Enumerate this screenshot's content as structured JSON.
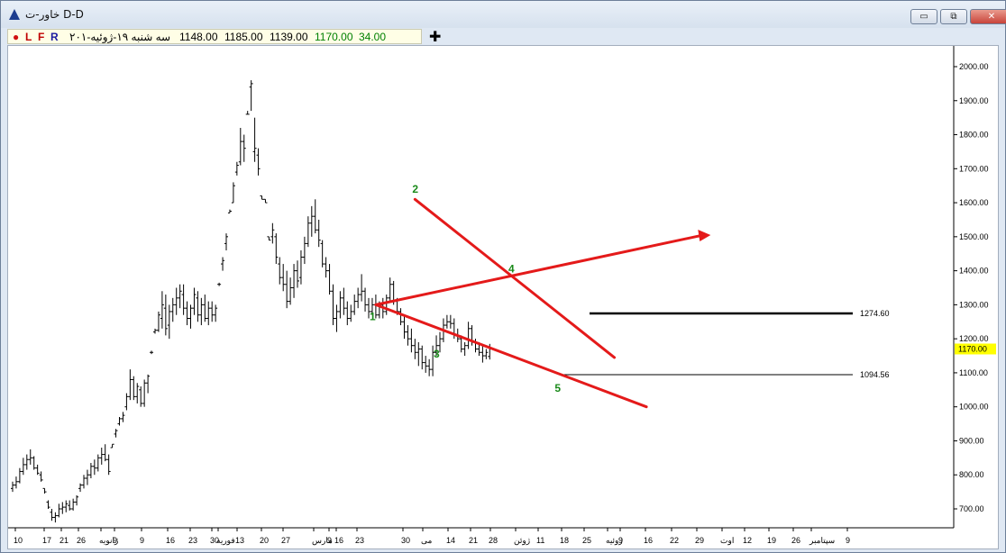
{
  "window": {
    "title": "خاور-ت D-D",
    "minimize_icon": "minimize-icon",
    "maximize_icon": "restore-icon",
    "close_icon": "close-icon",
    "minimize_label": "▭",
    "restore_label": "⧉",
    "close_label": "✕"
  },
  "infobar": {
    "dot": "●",
    "l": "L",
    "f": "F",
    "r": "R",
    "date": "سه شنبه ۱۹-ژوئیه-۲۰۱",
    "open": "1148.00",
    "high": "1185.00",
    "low": "1139.00",
    "close": "1170.00",
    "change": "34.00",
    "colors": {
      "dot": "#d01010",
      "l": "#c00000",
      "f": "#c00000",
      "r": "#1a1aa0",
      "close": "#008000",
      "change": "#008000"
    }
  },
  "toolbar": {
    "add_label": "✚",
    "add_icon": "crosshair-plus-icon"
  },
  "chart_data": {
    "type": "ohlc-bar",
    "y_axis": {
      "min": 600,
      "max": 2050,
      "ticks": [
        700,
        800,
        900,
        1000,
        1100,
        1200,
        1300,
        1400,
        1500,
        1600,
        1700,
        1800,
        1900,
        2000
      ],
      "tick_labels": [
        "700.00",
        "800.00",
        "900.00",
        "1000.00",
        "1100.00",
        "1200.00",
        "1300.00",
        "1400.00",
        "1500.00",
        "1600.00",
        "1700.00",
        "1800.00",
        "1900.00",
        "2000.00"
      ]
    },
    "x_axis": {
      "labels": [
        "10",
        "17",
        "21",
        "26",
        "9",
        "ژانویه",
        "9",
        "16",
        "23",
        "30",
        "فوریه",
        "13",
        "20",
        "27",
        "مارس",
        "9",
        "16",
        "23",
        "30",
        "می",
        "14",
        "21",
        "28",
        "ژوئن",
        "11",
        "18",
        "25",
        "ژوئیه",
        "9",
        "16",
        "22",
        "29",
        "اوت",
        "12",
        "19",
        "26",
        "سپتامبر",
        "9"
      ]
    },
    "last_price": {
      "value": 1170.0,
      "label": "1170.00",
      "color": "#ffff00"
    },
    "levels": [
      {
        "value": 1274.6,
        "label": "1274.60",
        "color": "#000000",
        "width": "thick"
      },
      {
        "value": 1094.56,
        "label": "1094.56",
        "color": "#000000",
        "width": "thin"
      }
    ],
    "wave_labels": [
      "1",
      "2",
      "3",
      "4",
      "5"
    ],
    "wave_label_color": "#1a8a1a",
    "line_color": "#e41a1a",
    "bars": [
      {
        "o": 760,
        "h": 780,
        "l": 750,
        "c": 770
      },
      {
        "o": 770,
        "h": 795,
        "l": 760,
        "c": 780
      },
      {
        "o": 780,
        "h": 820,
        "l": 775,
        "c": 810
      },
      {
        "o": 810,
        "h": 850,
        "l": 800,
        "c": 830
      },
      {
        "o": 830,
        "h": 860,
        "l": 815,
        "c": 845
      },
      {
        "o": 845,
        "h": 875,
        "l": 830,
        "c": 850
      },
      {
        "o": 850,
        "h": 855,
        "l": 815,
        "c": 820
      },
      {
        "o": 820,
        "h": 830,
        "l": 800,
        "c": 805
      },
      {
        "o": 800,
        "h": 810,
        "l": 780,
        "c": 785
      },
      {
        "o": 760,
        "h": 760,
        "l": 745,
        "c": 750
      },
      {
        "o": 720,
        "h": 725,
        "l": 700,
        "c": 705
      },
      {
        "o": 690,
        "h": 700,
        "l": 665,
        "c": 675
      },
      {
        "o": 675,
        "h": 690,
        "l": 660,
        "c": 680
      },
      {
        "o": 680,
        "h": 715,
        "l": 675,
        "c": 700
      },
      {
        "o": 700,
        "h": 720,
        "l": 685,
        "c": 705
      },
      {
        "o": 705,
        "h": 725,
        "l": 690,
        "c": 715
      },
      {
        "o": 710,
        "h": 725,
        "l": 695,
        "c": 700
      },
      {
        "o": 700,
        "h": 730,
        "l": 695,
        "c": 720
      },
      {
        "o": 720,
        "h": 740,
        "l": 710,
        "c": 735
      },
      {
        "o": 760,
        "h": 775,
        "l": 750,
        "c": 770
      },
      {
        "o": 770,
        "h": 800,
        "l": 760,
        "c": 790
      },
      {
        "o": 790,
        "h": 815,
        "l": 770,
        "c": 800
      },
      {
        "o": 800,
        "h": 835,
        "l": 790,
        "c": 825
      },
      {
        "o": 825,
        "h": 845,
        "l": 800,
        "c": 820
      },
      {
        "o": 820,
        "h": 860,
        "l": 810,
        "c": 850
      },
      {
        "o": 850,
        "h": 880,
        "l": 830,
        "c": 860
      },
      {
        "o": 860,
        "h": 890,
        "l": 840,
        "c": 845
      },
      {
        "o": 845,
        "h": 860,
        "l": 800,
        "c": 810
      },
      {
        "o": 880,
        "h": 890,
        "l": 880,
        "c": 890
      },
      {
        "o": 920,
        "h": 935,
        "l": 910,
        "c": 930
      },
      {
        "o": 950,
        "h": 970,
        "l": 945,
        "c": 965
      },
      {
        "o": 965,
        "h": 985,
        "l": 955,
        "c": 975
      },
      {
        "o": 1000,
        "h": 1040,
        "l": 990,
        "c": 1030
      },
      {
        "o": 1030,
        "h": 1110,
        "l": 1020,
        "c": 1080
      },
      {
        "o": 1080,
        "h": 1090,
        "l": 1020,
        "c": 1030
      },
      {
        "o": 1030,
        "h": 1070,
        "l": 1010,
        "c": 1060
      },
      {
        "o": 1050,
        "h": 1060,
        "l": 1000,
        "c": 1010
      },
      {
        "o": 1010,
        "h": 1080,
        "l": 1000,
        "c": 1070
      },
      {
        "o": 1070,
        "h": 1095,
        "l": 1040,
        "c": 1090
      },
      {
        "o": 1160,
        "h": 1165,
        "l": 1155,
        "c": 1160
      },
      {
        "o": 1220,
        "h": 1230,
        "l": 1215,
        "c": 1225
      },
      {
        "o": 1225,
        "h": 1280,
        "l": 1220,
        "c": 1270
      },
      {
        "o": 1260,
        "h": 1340,
        "l": 1230,
        "c": 1300
      },
      {
        "o": 1290,
        "h": 1330,
        "l": 1210,
        "c": 1230
      },
      {
        "o": 1240,
        "h": 1300,
        "l": 1200,
        "c": 1280
      },
      {
        "o": 1280,
        "h": 1320,
        "l": 1250,
        "c": 1300
      },
      {
        "o": 1300,
        "h": 1350,
        "l": 1270,
        "c": 1320
      },
      {
        "o": 1320,
        "h": 1360,
        "l": 1290,
        "c": 1340
      },
      {
        "o": 1330,
        "h": 1360,
        "l": 1270,
        "c": 1290
      },
      {
        "o": 1290,
        "h": 1310,
        "l": 1240,
        "c": 1260
      },
      {
        "o": 1260,
        "h": 1300,
        "l": 1230,
        "c": 1290
      },
      {
        "o": 1290,
        "h": 1350,
        "l": 1270,
        "c": 1330
      },
      {
        "o": 1320,
        "h": 1340,
        "l": 1250,
        "c": 1270
      },
      {
        "o": 1270,
        "h": 1320,
        "l": 1240,
        "c": 1300
      },
      {
        "o": 1300,
        "h": 1330,
        "l": 1250,
        "c": 1260
      },
      {
        "o": 1260,
        "h": 1310,
        "l": 1240,
        "c": 1290
      },
      {
        "o": 1290,
        "h": 1310,
        "l": 1250,
        "c": 1270
      },
      {
        "o": 1270,
        "h": 1300,
        "l": 1250,
        "c": 1290
      },
      {
        "o": 1360,
        "h": 1365,
        "l": 1355,
        "c": 1360
      },
      {
        "o": 1420,
        "h": 1440,
        "l": 1400,
        "c": 1430
      },
      {
        "o": 1480,
        "h": 1510,
        "l": 1460,
        "c": 1500
      },
      {
        "o": 1570,
        "h": 1580,
        "l": 1570,
        "c": 1575
      },
      {
        "o": 1600,
        "h": 1660,
        "l": 1600,
        "c": 1650
      },
      {
        "o": 1690,
        "h": 1720,
        "l": 1680,
        "c": 1710
      },
      {
        "o": 1720,
        "h": 1820,
        "l": 1710,
        "c": 1780
      },
      {
        "o": 1780,
        "h": 1800,
        "l": 1720,
        "c": 1760
      },
      {
        "o": 1860,
        "h": 1870,
        "l": 1860,
        "c": 1860
      },
      {
        "o": 1940,
        "h": 1960,
        "l": 1870,
        "c": 1950
      },
      {
        "o": 1750,
        "h": 1850,
        "l": 1720,
        "c": 1760
      },
      {
        "o": 1740,
        "h": 1760,
        "l": 1680,
        "c": 1700
      },
      {
        "o": 1620,
        "h": 1620,
        "l": 1610,
        "c": 1610
      },
      {
        "o": 1610,
        "h": 1610,
        "l": 1600,
        "c": 1600
      },
      {
        "o": 1500,
        "h": 1500,
        "l": 1490,
        "c": 1490
      },
      {
        "o": 1500,
        "h": 1540,
        "l": 1480,
        "c": 1520
      },
      {
        "o": 1500,
        "h": 1510,
        "l": 1420,
        "c": 1440
      },
      {
        "o": 1420,
        "h": 1440,
        "l": 1360,
        "c": 1380
      },
      {
        "o": 1380,
        "h": 1420,
        "l": 1340,
        "c": 1360
      },
      {
        "o": 1360,
        "h": 1400,
        "l": 1290,
        "c": 1310
      },
      {
        "o": 1310,
        "h": 1380,
        "l": 1300,
        "c": 1350
      },
      {
        "o": 1350,
        "h": 1420,
        "l": 1320,
        "c": 1400
      },
      {
        "o": 1400,
        "h": 1430,
        "l": 1350,
        "c": 1370
      },
      {
        "o": 1380,
        "h": 1460,
        "l": 1360,
        "c": 1440
      },
      {
        "o": 1440,
        "h": 1500,
        "l": 1420,
        "c": 1480
      },
      {
        "o": 1480,
        "h": 1560,
        "l": 1470,
        "c": 1540
      },
      {
        "o": 1540,
        "h": 1590,
        "l": 1500,
        "c": 1560
      },
      {
        "o": 1560,
        "h": 1610,
        "l": 1510,
        "c": 1520
      },
      {
        "o": 1520,
        "h": 1550,
        "l": 1470,
        "c": 1490
      },
      {
        "o": 1480,
        "h": 1490,
        "l": 1410,
        "c": 1420
      },
      {
        "o": 1420,
        "h": 1440,
        "l": 1380,
        "c": 1400
      },
      {
        "o": 1400,
        "h": 1420,
        "l": 1330,
        "c": 1340
      },
      {
        "o": 1340,
        "h": 1360,
        "l": 1240,
        "c": 1260
      },
      {
        "o": 1260,
        "h": 1300,
        "l": 1220,
        "c": 1280
      },
      {
        "o": 1280,
        "h": 1340,
        "l": 1260,
        "c": 1320
      },
      {
        "o": 1320,
        "h": 1350,
        "l": 1270,
        "c": 1290
      },
      {
        "o": 1290,
        "h": 1310,
        "l": 1240,
        "c": 1260
      },
      {
        "o": 1260,
        "h": 1300,
        "l": 1250,
        "c": 1280
      },
      {
        "o": 1280,
        "h": 1330,
        "l": 1270,
        "c": 1310
      },
      {
        "o": 1310,
        "h": 1350,
        "l": 1290,
        "c": 1330
      },
      {
        "o": 1330,
        "h": 1390,
        "l": 1310,
        "c": 1340
      },
      {
        "o": 1340,
        "h": 1350,
        "l": 1280,
        "c": 1300
      },
      {
        "o": 1300,
        "h": 1320,
        "l": 1260,
        "c": 1280
      },
      {
        "o": 1280,
        "h": 1320,
        "l": 1270,
        "c": 1300
      },
      {
        "o": 1300,
        "h": 1330,
        "l": 1260,
        "c": 1270
      },
      {
        "o": 1270,
        "h": 1310,
        "l": 1260,
        "c": 1300
      },
      {
        "o": 1300,
        "h": 1320,
        "l": 1260,
        "c": 1280
      },
      {
        "o": 1280,
        "h": 1330,
        "l": 1270,
        "c": 1320
      },
      {
        "o": 1320,
        "h": 1380,
        "l": 1310,
        "c": 1360
      },
      {
        "o": 1360,
        "h": 1370,
        "l": 1300,
        "c": 1310
      },
      {
        "o": 1310,
        "h": 1320,
        "l": 1270,
        "c": 1280
      },
      {
        "o": 1280,
        "h": 1290,
        "l": 1240,
        "c": 1250
      },
      {
        "o": 1250,
        "h": 1270,
        "l": 1200,
        "c": 1220
      },
      {
        "o": 1220,
        "h": 1240,
        "l": 1180,
        "c": 1200
      },
      {
        "o": 1200,
        "h": 1230,
        "l": 1160,
        "c": 1180
      },
      {
        "o": 1180,
        "h": 1200,
        "l": 1140,
        "c": 1160
      },
      {
        "o": 1160,
        "h": 1190,
        "l": 1120,
        "c": 1170
      },
      {
        "o": 1170,
        "h": 1180,
        "l": 1110,
        "c": 1130
      },
      {
        "o": 1130,
        "h": 1150,
        "l": 1100,
        "c": 1120
      },
      {
        "o": 1120,
        "h": 1140,
        "l": 1090,
        "c": 1110
      },
      {
        "o": 1110,
        "h": 1180,
        "l": 1090,
        "c": 1160
      },
      {
        "o": 1160,
        "h": 1210,
        "l": 1150,
        "c": 1180
      },
      {
        "o": 1180,
        "h": 1220,
        "l": 1160,
        "c": 1200
      },
      {
        "o": 1200,
        "h": 1260,
        "l": 1190,
        "c": 1240
      },
      {
        "o": 1240,
        "h": 1270,
        "l": 1230,
        "c": 1250
      },
      {
        "o": 1250,
        "h": 1270,
        "l": 1230,
        "c": 1245
      },
      {
        "o": 1245,
        "h": 1260,
        "l": 1200,
        "c": 1210
      },
      {
        "o": 1210,
        "h": 1230,
        "l": 1190,
        "c": 1200
      },
      {
        "o": 1200,
        "h": 1210,
        "l": 1160,
        "c": 1170
      },
      {
        "o": 1170,
        "h": 1190,
        "l": 1150,
        "c": 1180
      },
      {
        "o": 1180,
        "h": 1250,
        "l": 1170,
        "c": 1230
      },
      {
        "o": 1230,
        "h": 1240,
        "l": 1180,
        "c": 1190
      },
      {
        "o": 1190,
        "h": 1200,
        "l": 1160,
        "c": 1170
      },
      {
        "o": 1170,
        "h": 1190,
        "l": 1150,
        "c": 1160
      },
      {
        "o": 1160,
        "h": 1180,
        "l": 1130,
        "c": 1150
      },
      {
        "o": 1150,
        "h": 1170,
        "l": 1140,
        "c": 1160
      },
      {
        "o": 1148,
        "h": 1185,
        "l": 1139,
        "c": 1170
      }
    ]
  }
}
